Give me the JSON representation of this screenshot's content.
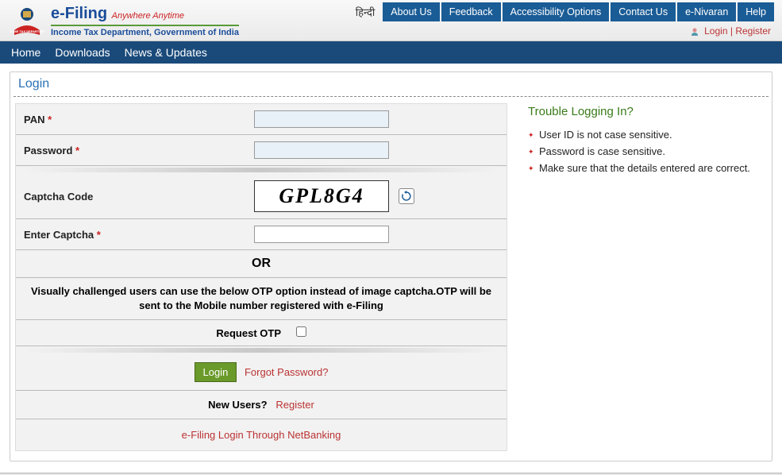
{
  "brand": {
    "name": "e-Filing",
    "tagline": "Anywhere Anytime",
    "dept": "Income Tax Department, Government of India"
  },
  "hindi": "हिन्दी",
  "topnav": [
    "About Us",
    "Feedback",
    "Accessibility Options",
    "Contact Us",
    "e-Nivaran",
    "Help"
  ],
  "auth": {
    "login": "Login",
    "sep": "|",
    "register": "Register"
  },
  "mainnav": [
    "Home",
    "Downloads",
    "News & Updates"
  ],
  "panel": {
    "title": "Login"
  },
  "form": {
    "pan_label": "PAN ",
    "pan_value": "",
    "pwd_label": "Password ",
    "pwd_value": "",
    "captcha_label": "Captcha Code",
    "captcha_value": "GPL8G4",
    "enter_captcha_label": "Enter Captcha ",
    "enter_captcha_value": "",
    "or": "OR",
    "otp_desc": "Visually challenged users can use the below OTP option instead of image captcha.OTP will be sent to the Mobile number registered with e-Filing",
    "request_otp": "Request OTP",
    "login_btn": "Login",
    "forgot": "Forgot Password?",
    "new_users_q": "New Users?",
    "new_users_reg": "Register",
    "netbanking": "e-Filing Login Through NetBanking"
  },
  "help": {
    "title": "Trouble Logging In?",
    "items": [
      "User ID is not case sensitive.",
      "Password is case sensitive.",
      "Make sure that the details entered are correct."
    ]
  }
}
